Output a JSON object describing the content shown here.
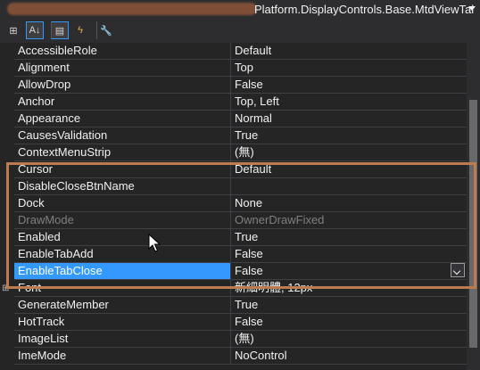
{
  "title": {
    "component": "Platform.DisplayControls.Base.MtdViewTal"
  },
  "toolbar": {
    "categorized_glyph": "⊞",
    "alphabetical_glyph": "A↓",
    "properties_glyph": "▤",
    "events_glyph": "ϟ",
    "pages_glyph": "🔧"
  },
  "properties": [
    {
      "name": "AccessibleRole",
      "value": "Default"
    },
    {
      "name": "Alignment",
      "value": "Top"
    },
    {
      "name": "AllowDrop",
      "value": "False"
    },
    {
      "name": "Anchor",
      "value": "Top, Left"
    },
    {
      "name": "Appearance",
      "value": "Normal"
    },
    {
      "name": "CausesValidation",
      "value": "True"
    },
    {
      "name": "ContextMenuStrip",
      "value": "(無)"
    },
    {
      "name": "Cursor",
      "value": "Default"
    },
    {
      "name": "DisableCloseBtnName",
      "value": ""
    },
    {
      "name": "Dock",
      "value": "None"
    },
    {
      "name": "DrawMode",
      "value": "OwnerDrawFixed"
    },
    {
      "name": "Enabled",
      "value": "True"
    },
    {
      "name": "EnableTabAdd",
      "value": "False"
    },
    {
      "name": "EnableTabClose",
      "value": "False"
    },
    {
      "name": "Font",
      "value": "新細明體, 12px"
    },
    {
      "name": "GenerateMember",
      "value": "True"
    },
    {
      "name": "HotTrack",
      "value": "False"
    },
    {
      "name": "ImageList",
      "value": "(無)"
    },
    {
      "name": "ImeMode",
      "value": "NoControl"
    }
  ]
}
